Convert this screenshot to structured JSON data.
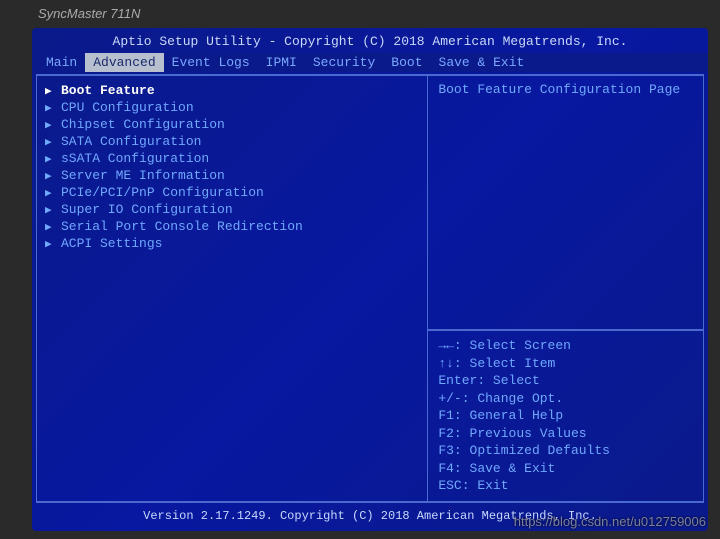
{
  "monitor_model": "SyncMaster 711N",
  "title": "Aptio Setup Utility - Copyright (C) 2018 American Megatrends, Inc.",
  "tabs": [
    {
      "label": "Main",
      "active": false
    },
    {
      "label": "Advanced",
      "active": true
    },
    {
      "label": "Event Logs",
      "active": false
    },
    {
      "label": "IPMI",
      "active": false
    },
    {
      "label": "Security",
      "active": false
    },
    {
      "label": "Boot",
      "active": false
    },
    {
      "label": "Save & Exit",
      "active": false
    }
  ],
  "menu": [
    {
      "label": "Boot Feature",
      "selected": true
    },
    {
      "label": "CPU Configuration",
      "selected": false
    },
    {
      "label": "Chipset Configuration",
      "selected": false
    },
    {
      "label": "SATA Configuration",
      "selected": false
    },
    {
      "label": "sSATA Configuration",
      "selected": false
    },
    {
      "label": "Server ME Information",
      "selected": false
    },
    {
      "label": "PCIe/PCI/PnP Configuration",
      "selected": false
    },
    {
      "label": "Super IO Configuration",
      "selected": false
    },
    {
      "label": "Serial Port Console Redirection",
      "selected": false
    },
    {
      "label": "ACPI Settings",
      "selected": false
    }
  ],
  "help_title": "Boot Feature Configuration Page",
  "keymap": [
    "→←: Select Screen",
    "↑↓: Select Item",
    "Enter: Select",
    "+/-: Change Opt.",
    "F1: General Help",
    "F2: Previous Values",
    "F3: Optimized Defaults",
    "F4: Save & Exit",
    "ESC: Exit"
  ],
  "footer": "Version 2.17.1249. Copyright (C) 2018 American Megatrends, Inc.",
  "watermark": "https://blog.csdn.net/u012759006"
}
